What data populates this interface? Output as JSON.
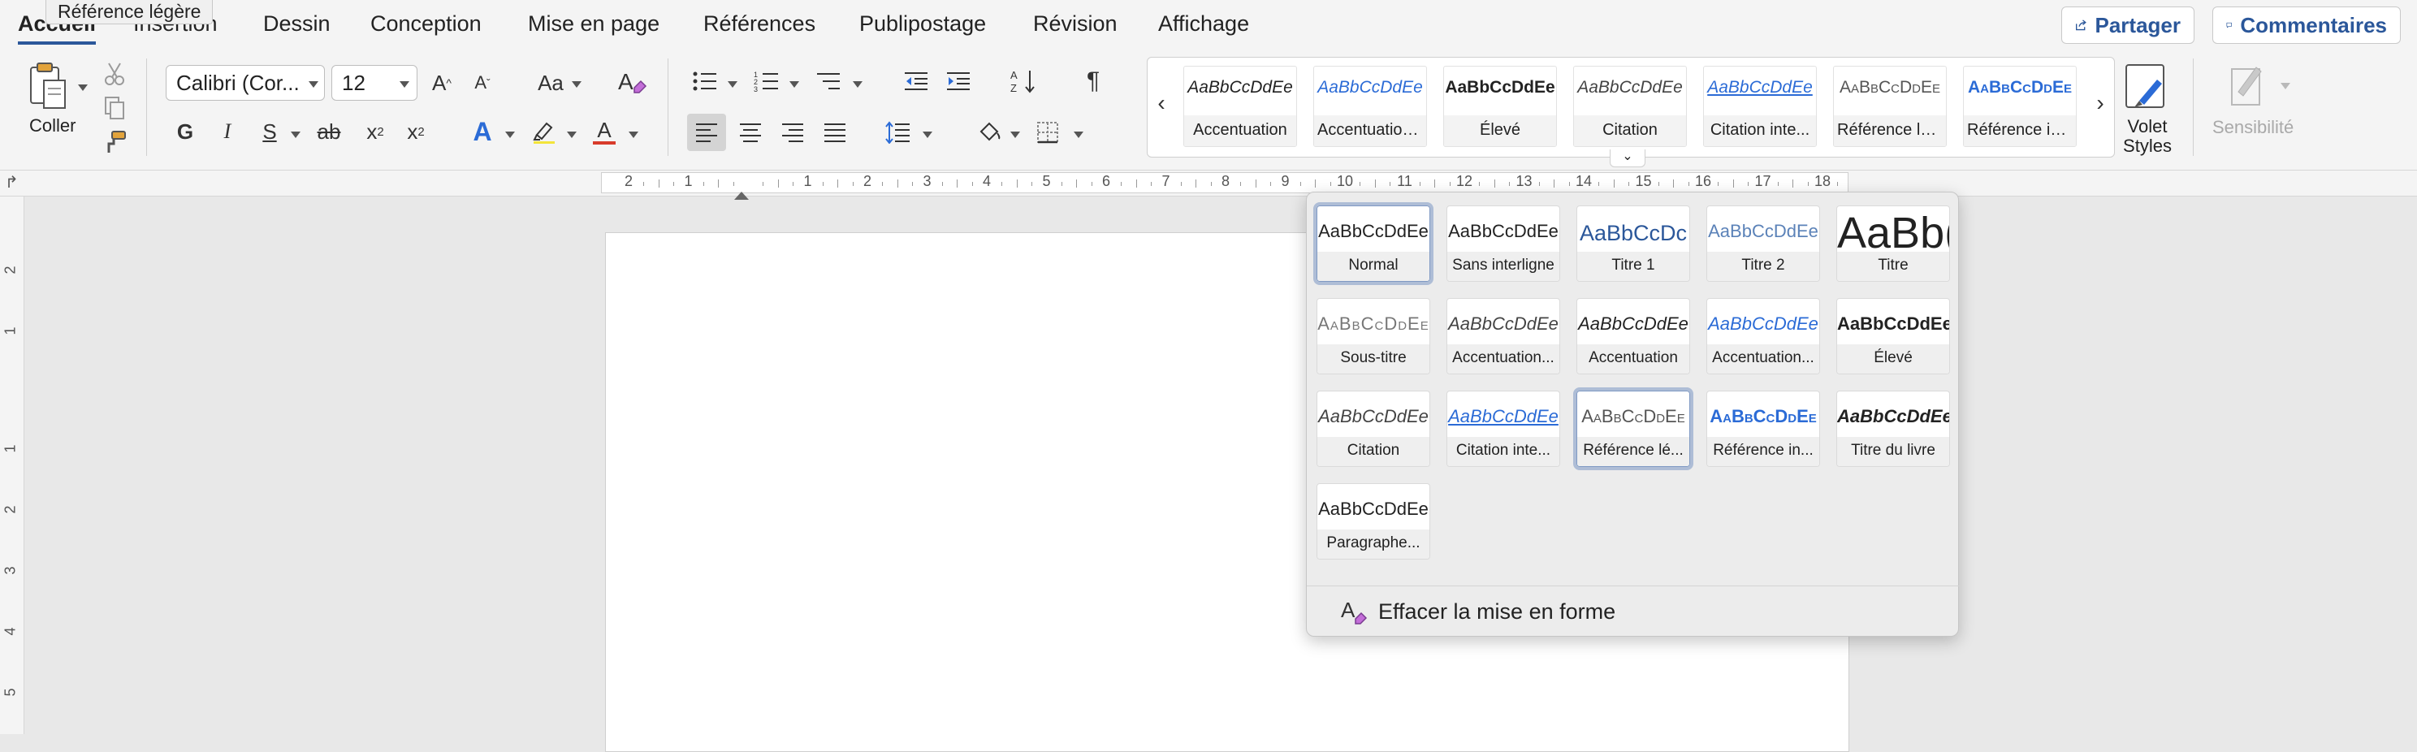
{
  "tooltip": "Référence légère",
  "tabs": [
    "Accueil",
    "Insertion",
    "Dessin",
    "Conception",
    "Mise en page",
    "Références",
    "Publipostage",
    "Révision",
    "Affichage"
  ],
  "share_label": "Partager",
  "comments_label": "Commentaires",
  "paste_label": "Coller",
  "font_name": "Calibri (Cor...",
  "font_size": "12",
  "format": {
    "bold": "G",
    "italic": "I",
    "underline": "S",
    "strike": "ab",
    "subscript": "x",
    "subscript_small": "2",
    "superscript": "x",
    "superscript_small": "2",
    "font_color_letter": "A",
    "text_effect_letter": "A",
    "case_label": "Aa",
    "grow_label": "A",
    "shrink_label": "A"
  },
  "accent_color": "#2b579a",
  "gallery": {
    "items": [
      {
        "sample": "AaBbCcDdEe",
        "label": "Accentuation"
      },
      {
        "sample": "AaBbCcDdEe",
        "label": "Accentuation..."
      },
      {
        "sample": "AaBbCcDdEe",
        "label": "Élevé"
      },
      {
        "sample": "AaBbCcDdEe",
        "label": "Citation"
      },
      {
        "sample": "AaBbCcDdEe",
        "label": "Citation inte..."
      },
      {
        "sample": "AaBbCcDdEe",
        "label": "Référence lé..."
      },
      {
        "sample": "AaBbCcDdEe",
        "label": "Référence in..."
      }
    ],
    "prev_icon": "chevron-left-icon",
    "next_icon": "chevron-right-icon"
  },
  "styles_pane_label": [
    "Volet",
    "Styles"
  ],
  "sensitivity_label": "Sensibilité",
  "ruler": {
    "labels": [
      "2",
      "1",
      "1",
      "2",
      "3",
      "4",
      "5",
      "6",
      "7",
      "8",
      "9",
      "10",
      "11",
      "12",
      "13",
      "14",
      "15",
      "16",
      "17",
      "18"
    ]
  },
  "vruler": {
    "labels": [
      "2",
      "1",
      "1",
      "2",
      "3",
      "4",
      "5"
    ]
  },
  "panel": {
    "rows": [
      [
        {
          "sample": "AaBbCcDdEe",
          "label": "Normal",
          "selected": true
        },
        {
          "sample": "AaBbCcDdEe",
          "label": "Sans interligne"
        },
        {
          "sample": "AaBbCcDc",
          "label": "Titre 1"
        },
        {
          "sample": "AaBbCcDdEe",
          "label": "Titre 2"
        },
        {
          "sample": "AaBb(",
          "label": "Titre"
        }
      ],
      [
        {
          "sample": "AaBbCcDdEe",
          "label": "Sous-titre"
        },
        {
          "sample": "AaBbCcDdEe",
          "label": "Accentuation..."
        },
        {
          "sample": "AaBbCcDdEe",
          "label": "Accentuation"
        },
        {
          "sample": "AaBbCcDdEe",
          "label": "Accentuation..."
        },
        {
          "sample": "AaBbCcDdEe",
          "label": "Élevé"
        }
      ],
      [
        {
          "sample": "AaBbCcDdEe",
          "label": "Citation"
        },
        {
          "sample": "AaBbCcDdEe",
          "label": "Citation inte..."
        },
        {
          "sample": "AaBbCcDdEe",
          "label": "Référence lé...",
          "hovered": true
        },
        {
          "sample": "AaBbCcDdEe",
          "label": "Référence in..."
        },
        {
          "sample": "AaBbCcDdEe",
          "label": "Titre du livre"
        }
      ],
      [
        {
          "sample": "AaBbCcDdEe",
          "label": "Paragraphe..."
        }
      ]
    ],
    "clear_label": "Effacer la mise en forme"
  }
}
